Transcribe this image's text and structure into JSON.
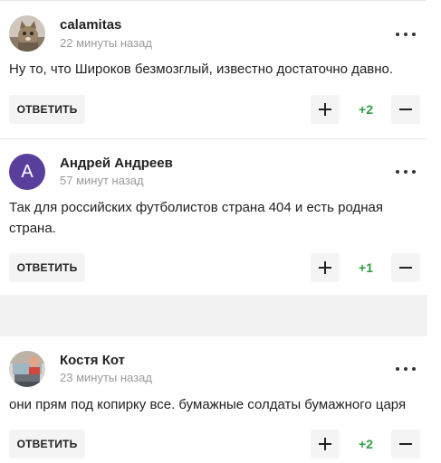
{
  "comments": [
    {
      "author": "calamitas",
      "time": "22 минуты назад",
      "text": "Ну то, что Широков безмозглый, известно достаточно давно.",
      "reply_label": "ОТВЕТИТЬ",
      "score": "+2",
      "avatar_icon": "cat-photo-avatar"
    },
    {
      "author": "Андрей Андреев",
      "time": "57 минут назад",
      "text": "Так для российских футболистов страна 404 и есть родная страна.",
      "reply_label": "ОТВЕТИТЬ",
      "score": "+1",
      "avatar_letter": "А",
      "avatar_color": "#5a3e9c"
    },
    {
      "author": "Костя Кот",
      "time": "23 минуты назад",
      "text": "они прям под копирку все. бумажные солдаты бумажного царя",
      "reply_label": "ОТВЕТИТЬ",
      "score": "+2",
      "avatar_icon": "photo-avatar"
    }
  ],
  "colors": {
    "score_green": "#2e9e44",
    "time_gray": "#9a9a9a",
    "button_bg": "#f4f4f4",
    "divider_block": "#f2f2f2"
  }
}
